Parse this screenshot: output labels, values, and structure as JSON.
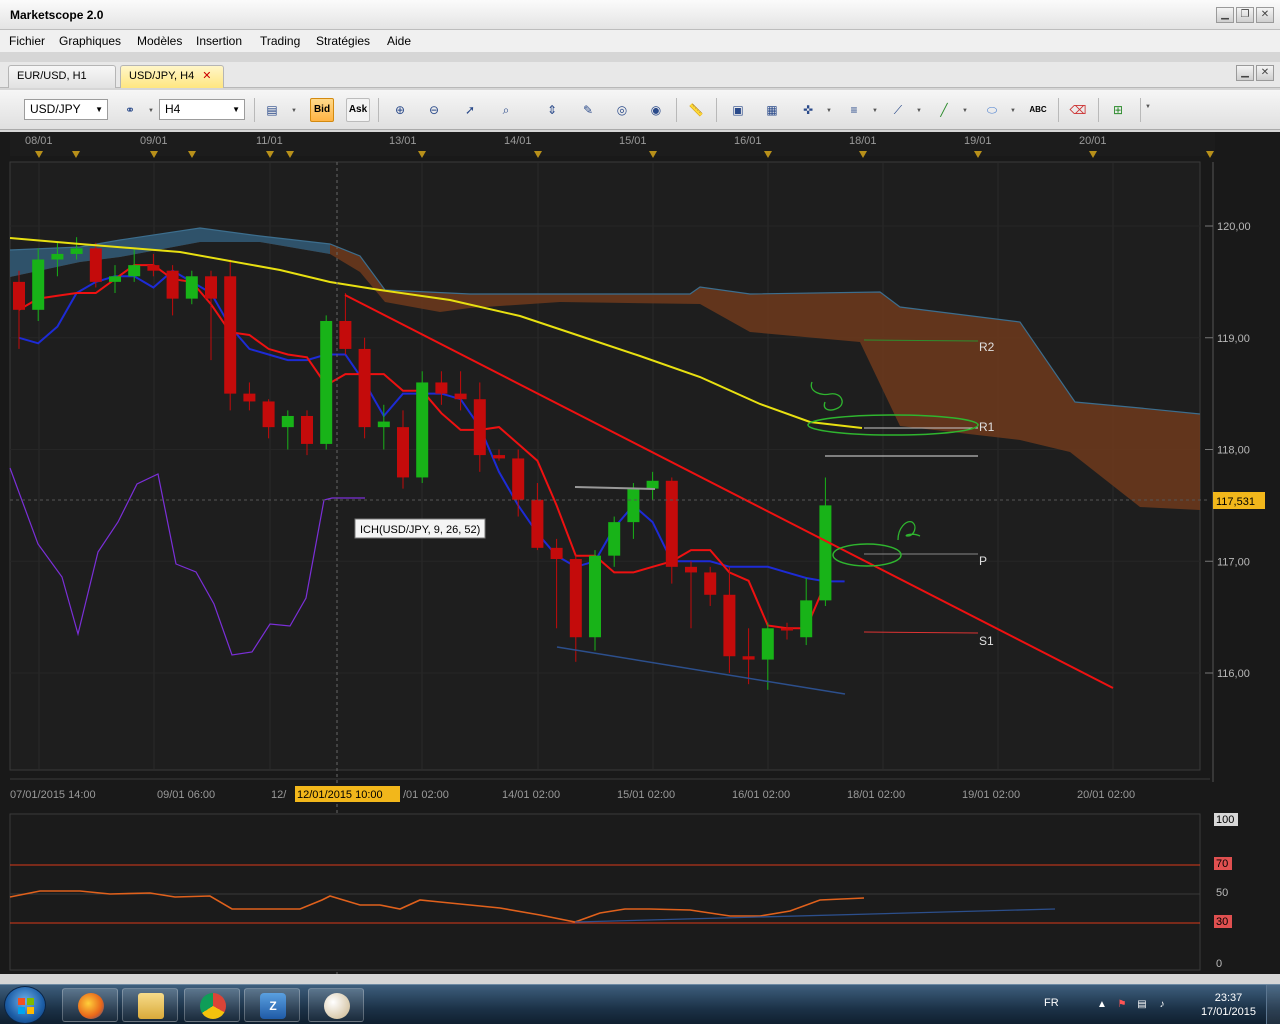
{
  "window": {
    "title": "Marketscope 2.0"
  },
  "menu": [
    "Fichier",
    "Graphiques",
    "Modèles",
    "Insertion",
    "Trading",
    "Stratégies",
    "Aide"
  ],
  "tabs": [
    {
      "label": "EUR/USD, H1",
      "active": false
    },
    {
      "label": "USD/JPY, H4",
      "active": true
    }
  ],
  "toolbar": {
    "instrument": "USD/JPY",
    "timeframe": "H4",
    "bid_label": "Bid",
    "ask_label": "Ask",
    "text_tool_label": "ABC"
  },
  "chart_data": {
    "type": "candlestick",
    "symbol": "USD/JPY",
    "timeframe": "H4",
    "indicator_label": "ICH(USD/JPY, 9, 26, 52)",
    "current_price": "117,531",
    "cursor_time": "12/01/2015 10:00",
    "top_dates": [
      "08/01",
      "09/01",
      "11/01",
      "13/01",
      "14/01",
      "15/01",
      "16/01",
      "18/01",
      "19/01",
      "20/01"
    ],
    "bottom_time_labels": [
      "07/01/2015 14:00",
      "09/01 06:00",
      "12/",
      "/01 02:00",
      "14/01 02:00",
      "15/01 02:00",
      "16/01 02:00",
      "18/01 02:00",
      "19/01 02:00",
      "20/01 02:00"
    ],
    "y_axis": {
      "ticks": [
        "120,00",
        "119,00",
        "118,00",
        "117,00",
        "116,00"
      ]
    },
    "pivot_labels": [
      "R2",
      "R1",
      "P",
      "S1"
    ],
    "rsi_axis": {
      "ticks": [
        "100",
        "70",
        "50",
        "30",
        "0"
      ]
    },
    "candles": [
      {
        "o": 119.5,
        "h": 119.6,
        "l": 118.9,
        "c": 119.25
      },
      {
        "o": 119.25,
        "h": 119.8,
        "l": 119.15,
        "c": 119.7
      },
      {
        "o": 119.7,
        "h": 119.85,
        "l": 119.55,
        "c": 119.75
      },
      {
        "o": 119.75,
        "h": 119.9,
        "l": 119.7,
        "c": 119.8
      },
      {
        "o": 119.8,
        "h": 119.85,
        "l": 119.45,
        "c": 119.5
      },
      {
        "o": 119.5,
        "h": 119.65,
        "l": 119.4,
        "c": 119.55
      },
      {
        "o": 119.55,
        "h": 119.8,
        "l": 119.5,
        "c": 119.65
      },
      {
        "o": 119.65,
        "h": 119.75,
        "l": 119.55,
        "c": 119.6
      },
      {
        "o": 119.6,
        "h": 119.65,
        "l": 119.2,
        "c": 119.35
      },
      {
        "o": 119.35,
        "h": 119.6,
        "l": 119.3,
        "c": 119.55
      },
      {
        "o": 119.55,
        "h": 119.6,
        "l": 118.8,
        "c": 119.35
      },
      {
        "o": 119.55,
        "h": 119.7,
        "l": 118.35,
        "c": 118.5
      },
      {
        "o": 118.5,
        "h": 118.6,
        "l": 118.35,
        "c": 118.43
      },
      {
        "o": 118.43,
        "h": 118.45,
        "l": 118.1,
        "c": 118.2
      },
      {
        "o": 118.2,
        "h": 118.35,
        "l": 118.0,
        "c": 118.3
      },
      {
        "o": 118.3,
        "h": 118.35,
        "l": 117.95,
        "c": 118.05
      },
      {
        "o": 118.05,
        "h": 119.2,
        "l": 118.0,
        "c": 119.15
      },
      {
        "o": 119.15,
        "h": 119.4,
        "l": 118.85,
        "c": 118.9
      },
      {
        "o": 118.9,
        "h": 119.0,
        "l": 118.1,
        "c": 118.2
      },
      {
        "o": 118.2,
        "h": 118.4,
        "l": 118.0,
        "c": 118.25
      },
      {
        "o": 118.2,
        "h": 118.35,
        "l": 117.65,
        "c": 117.75
      },
      {
        "o": 117.75,
        "h": 118.7,
        "l": 117.7,
        "c": 118.6
      },
      {
        "o": 118.6,
        "h": 118.7,
        "l": 118.4,
        "c": 118.5
      },
      {
        "o": 118.5,
        "h": 118.7,
        "l": 118.35,
        "c": 118.45
      },
      {
        "o": 118.45,
        "h": 118.6,
        "l": 117.8,
        "c": 117.95
      },
      {
        "o": 117.95,
        "h": 118.0,
        "l": 117.9,
        "c": 117.92
      },
      {
        "o": 117.92,
        "h": 118.0,
        "l": 117.4,
        "c": 117.55
      },
      {
        "o": 117.55,
        "h": 117.7,
        "l": 117.1,
        "c": 117.12
      },
      {
        "o": 117.12,
        "h": 117.2,
        "l": 116.4,
        "c": 117.02
      },
      {
        "o": 117.02,
        "h": 117.05,
        "l": 116.1,
        "c": 116.32
      },
      {
        "o": 116.32,
        "h": 117.1,
        "l": 116.2,
        "c": 117.05
      },
      {
        "o": 117.05,
        "h": 117.4,
        "l": 116.95,
        "c": 117.35
      },
      {
        "o": 117.35,
        "h": 117.7,
        "l": 117.2,
        "c": 117.65
      },
      {
        "o": 117.65,
        "h": 117.8,
        "l": 117.55,
        "c": 117.72
      },
      {
        "o": 117.72,
        "h": 117.75,
        "l": 116.8,
        "c": 116.95
      },
      {
        "o": 116.95,
        "h": 117.0,
        "l": 116.4,
        "c": 116.9
      },
      {
        "o": 116.9,
        "h": 116.95,
        "l": 116.6,
        "c": 116.7
      },
      {
        "o": 116.7,
        "h": 116.95,
        "l": 116.0,
        "c": 116.15
      },
      {
        "o": 116.15,
        "h": 116.4,
        "l": 115.9,
        "c": 116.12
      },
      {
        "o": 116.12,
        "h": 116.45,
        "l": 115.85,
        "c": 116.4
      },
      {
        "o": 116.4,
        "h": 116.45,
        "l": 116.3,
        "c": 116.38
      },
      {
        "o": 116.32,
        "h": 116.85,
        "l": 116.25,
        "c": 116.65
      },
      {
        "o": 116.65,
        "h": 117.75,
        "l": 116.6,
        "c": 117.5
      }
    ],
    "tenkan": [
      119.0,
      118.95,
      119.1,
      119.4,
      119.5,
      119.55,
      119.55,
      119.45,
      119.6,
      119.5,
      119.4,
      119.1,
      118.9,
      118.85,
      118.8,
      118.8,
      118.85,
      118.85,
      118.6,
      118.3,
      118.5,
      118.5,
      118.5,
      118.45,
      118.2,
      117.8,
      117.5,
      117.25,
      117.05,
      116.95,
      117.0,
      117.3,
      117.5,
      117.35,
      117.0,
      117.0,
      117.0,
      116.95,
      116.95,
      116.95,
      116.9,
      116.85,
      116.82,
      116.82
    ]
  }
}
